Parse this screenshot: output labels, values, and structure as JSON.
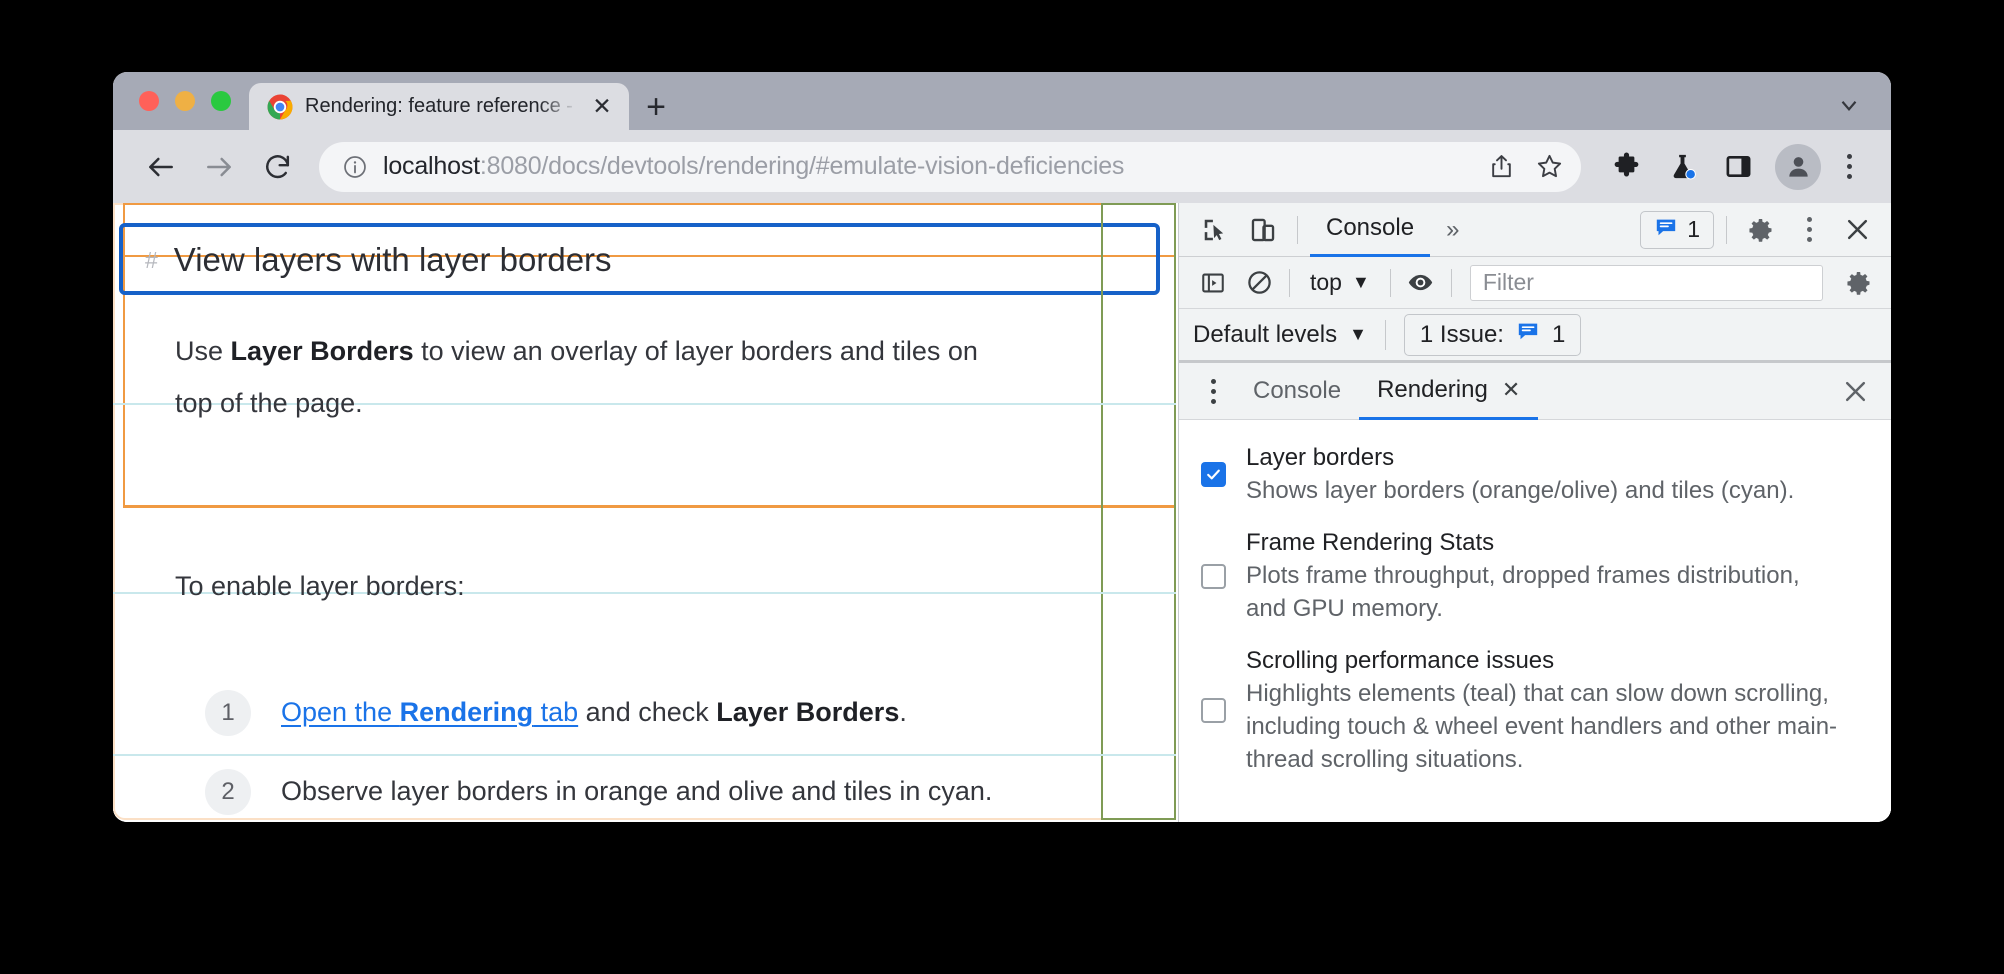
{
  "browser": {
    "tab": {
      "title": "Rendering: feature reference -",
      "favicon": "chrome-logo-icon",
      "close_label": "✕"
    },
    "new_tab_label": "+",
    "omnibox": {
      "info_icon": "info-icon",
      "url_host": "localhost",
      "url_rest": ":8080/docs/devtools/rendering/#emulate-vision-deficiencies",
      "share_icon": "share-icon",
      "bookmark_icon": "star-icon"
    },
    "toolbar_icons": [
      "extensions-puzzle-icon",
      "experiments-flask-icon",
      "side-panel-icon",
      "profile-avatar-icon",
      "chrome-menu-kebab-icon"
    ],
    "nav": {
      "back": "back-arrow-icon",
      "forward": "forward-arrow-icon",
      "reload": "reload-icon"
    }
  },
  "page": {
    "heading_anchor": "#",
    "heading": "View layers with layer borders",
    "paragraph1_pre": "Use ",
    "paragraph1_bold": "Layer Borders",
    "paragraph1_post": " to view an overlay of layer borders and tiles on",
    "paragraph1_line2": "top of the page.",
    "paragraph2": "To enable layer borders:",
    "steps": [
      {
        "num": "1",
        "link_pre": "Open the ",
        "link_bold": "Rendering",
        "link_post": " tab",
        "mid": " and check ",
        "bold": "Layer Borders",
        "tail": "."
      },
      {
        "num": "2",
        "text": "Observe layer borders in orange and olive and tiles in cyan."
      }
    ],
    "overlay_colors": {
      "layer_border_orange": "#f09a42",
      "layer_border_olive": "#7f9b55",
      "layer_border_blue": "#1661c8",
      "tile_cyan": "#c9e8ec"
    }
  },
  "devtools": {
    "main_toolbar": {
      "inspect_icon": "inspect-element-icon",
      "device_toggle_icon": "device-toolbar-icon",
      "active_tab": "Console",
      "more_tabs": "»",
      "issues_count": "1",
      "issues_icon": "issue-message-icon",
      "settings_icon": "gear-icon",
      "menu_icon": "kebab-menu-icon",
      "close_icon": "close-icon"
    },
    "console_toolbar": {
      "sidebar_icon": "console-sidebar-icon",
      "clear_icon": "clear-console-icon",
      "context": "top",
      "context_caret": "▼",
      "eye_icon": "live-expression-eye-icon",
      "filter_placeholder": "Filter",
      "settings_icon": "gear-icon"
    },
    "levels_bar": {
      "default_levels": "Default levels",
      "caret": "▼",
      "issue_label": "1 Issue:",
      "issue_icon": "issue-message-icon",
      "issue_count": "1"
    },
    "drawer": {
      "menu_icon": "kebab-menu-icon",
      "tabs": [
        {
          "label": "Console",
          "active": false,
          "closable": false
        },
        {
          "label": "Rendering",
          "active": true,
          "closable": true,
          "close_label": "✕"
        }
      ],
      "close_icon": "close-icon",
      "close_label": "✕"
    },
    "rendering_options": [
      {
        "title": "Layer borders",
        "description": "Shows layer borders (orange/olive) and tiles (cyan).",
        "checked": true
      },
      {
        "title": "Frame Rendering Stats",
        "description": "Plots frame throughput, dropped frames distribution, and GPU memory.",
        "checked": false
      },
      {
        "title": "Scrolling performance issues",
        "description": "Highlights elements (teal) that can slow down scrolling, including touch & wheel event handlers and other main-thread scrolling situations.",
        "checked": false
      }
    ],
    "accent_color": "#1a73e8"
  }
}
